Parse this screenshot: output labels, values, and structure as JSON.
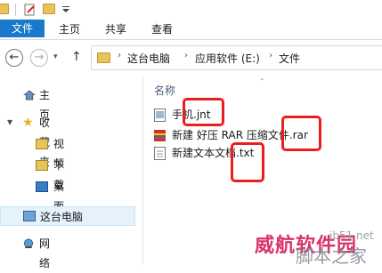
{
  "ribbon": {
    "tabs": [
      "文件",
      "主页",
      "共享",
      "查看"
    ]
  },
  "address": {
    "segments": [
      "这台电脑",
      "应用软件 (E:)",
      "文件"
    ]
  },
  "sidebar": {
    "home": "主页",
    "favorites": "收藏夹",
    "items": [
      "视频",
      "下载",
      "桌面"
    ],
    "this_pc": "这台电脑",
    "network": "网络"
  },
  "content": {
    "column_header": "名称",
    "files": [
      {
        "name": "手机.jnt",
        "icon": "jnt-file-icon"
      },
      {
        "name": "新建 好压 RAR 压缩文件.rar",
        "icon": "rar-archive-icon"
      },
      {
        "name": "新建文本文档.txt",
        "icon": "text-file-icon"
      }
    ]
  },
  "watermark": {
    "main": "威航软件园",
    "brand": "脚本之家",
    "url": "jb51.net"
  },
  "colors": {
    "accent": "#1979ca",
    "highlight_box": "#ee1d1d"
  }
}
